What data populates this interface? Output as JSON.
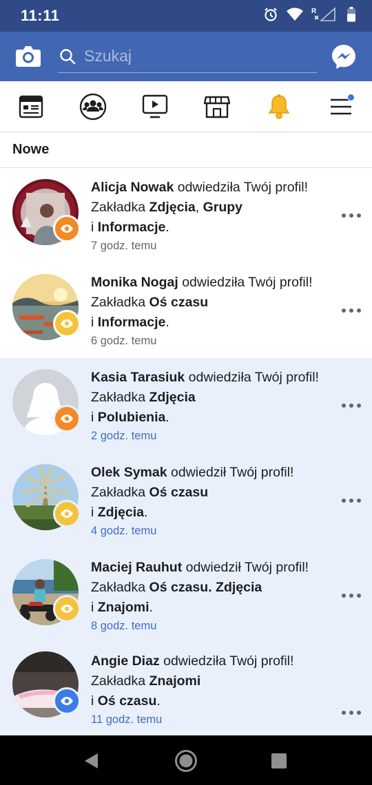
{
  "status_bar": {
    "time": "11:11"
  },
  "search": {
    "placeholder": "Szukaj"
  },
  "section": {
    "title": "Nowe"
  },
  "notifications": [
    {
      "name": "Alicja Nowak",
      "verb": "odwiedziła Twój profil! Zakładka",
      "tab1": "Zdjęcia",
      "sep": ",",
      "tab2": "Grupy",
      "conj": "i",
      "tab3": "Informacje",
      "end": ".",
      "time": "7 godz. temu",
      "badge_color": "#f28a26",
      "unread": false
    },
    {
      "name": "Monika Nogaj",
      "verb": "odwiedziła Twój profil! Zakładka",
      "tab1": "Oś czasu",
      "conj": "i",
      "tab2": "Informacje",
      "end": ".",
      "time": "6 godz. temu",
      "badge_color": "#f5c33b",
      "unread": false
    },
    {
      "name": "Kasia Tarasiuk",
      "verb": "odwiedziła Twój profil! Zakładka",
      "tab1": "Zdjęcia",
      "conj": "i",
      "tab2": "Polubienia",
      "end": ".",
      "time": "2 godz. temu",
      "badge_color": "#f28a26",
      "unread": true
    },
    {
      "name": "Olek Symak",
      "verb": "odwiedził Twój profil! Zakładka",
      "tab1": "Oś czasu",
      "conj": "i",
      "tab2": "Zdjęcia",
      "end": ".",
      "time": "4 godz. temu",
      "badge_color": "#f5c33b",
      "unread": true
    },
    {
      "name": "Maciej Rauhut",
      "verb": "odwiedził Twój profil! Zakładka",
      "tab1": "Oś czasu",
      "sep": ".",
      "tab2": "Zdjęcia",
      "conj": "i",
      "tab3": "Znajomi",
      "end": ".",
      "time": "8 godz. temu",
      "badge_color": "#f5c33b",
      "unread": true
    },
    {
      "name": "Angie Diaz",
      "verb": "odwiedziła Twój profil! Zakładka",
      "tab1": "Znajomi",
      "conj": "i",
      "tab2": "Oś czasu",
      "end": ".",
      "time": "11 godz. temu",
      "badge_color": "#3b7ce6",
      "unread": true
    }
  ],
  "colors": {
    "header_blue": "#4267b2",
    "status_blue": "#2f4a86",
    "unread_bg": "#e9f0fb",
    "accent": "#3578e5"
  },
  "icons": [
    "camera-icon",
    "search-icon",
    "messenger-icon",
    "news-feed-icon",
    "groups-icon",
    "watch-icon",
    "marketplace-icon",
    "bell-icon",
    "menu-icon",
    "eye-icon",
    "more-icon",
    "back-icon",
    "home-icon",
    "recents-icon"
  ]
}
